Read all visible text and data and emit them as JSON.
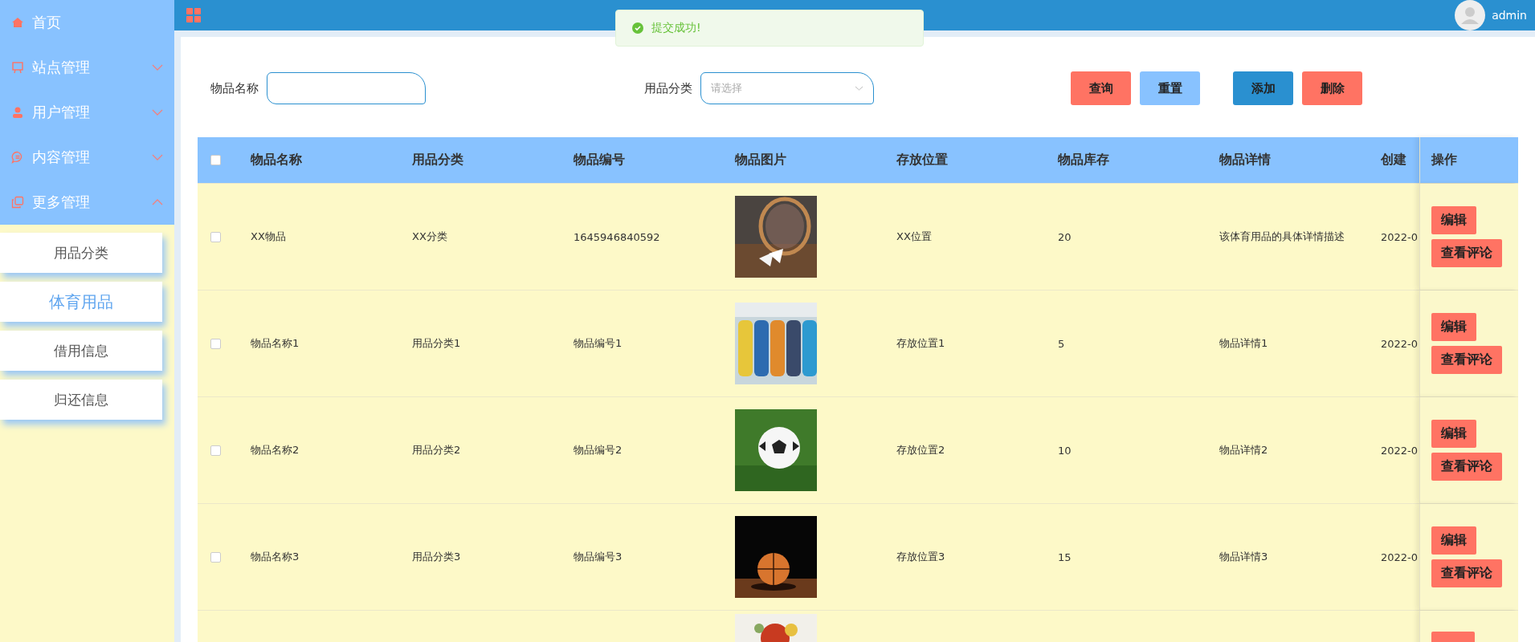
{
  "sidebar": {
    "menu": [
      {
        "label": "首页",
        "kind": "link"
      },
      {
        "label": "站点管理",
        "kind": "submenu",
        "expanded": false
      },
      {
        "label": "用户管理",
        "kind": "submenu",
        "expanded": false
      },
      {
        "label": "内容管理",
        "kind": "submenu",
        "expanded": false
      },
      {
        "label": "更多管理",
        "kind": "submenu",
        "expanded": true
      }
    ],
    "submenu": [
      {
        "label": "用品分类",
        "selected": false
      },
      {
        "label": "体育用品",
        "selected": true
      },
      {
        "label": "借用信息",
        "selected": false
      },
      {
        "label": "归还信息",
        "selected": false
      }
    ]
  },
  "header": {
    "user": "admin"
  },
  "toast": {
    "text": "提交成功!"
  },
  "filters": [
    {
      "label": "物品名称",
      "kind": "input"
    },
    {
      "label": "用品分类",
      "kind": "select",
      "placeholder": "请选择"
    }
  ],
  "buttons": [
    {
      "label": "查询",
      "kind": "danger"
    },
    {
      "label": "重置",
      "kind": "info"
    },
    {
      "label": "添加",
      "kind": "primary"
    },
    {
      "label": "删除",
      "kind": "danger"
    }
  ],
  "table": {
    "all_checked": false,
    "columns": [
      "物品名称",
      "用品分类",
      "物品编号",
      "物品图片",
      "存放位置",
      "物品库存",
      "物品详情",
      "创建",
      "操作"
    ],
    "rows": [
      {
        "checked": false,
        "cells": [
          "XX物品",
          "XX分类",
          "1645946840592",
          "",
          "XX位置",
          "20",
          "该体育用品的具体详情描述",
          "2022-0"
        ],
        "actions": [
          "编辑",
          "查看评论"
        ]
      },
      {
        "checked": false,
        "cells": [
          "物品名称1",
          "用品分类1",
          "物品编号1",
          "",
          "存放位置1",
          "5",
          "物品详情1",
          "2022-0"
        ],
        "actions": [
          "编辑",
          "查看评论"
        ]
      },
      {
        "checked": false,
        "cells": [
          "物品名称2",
          "用品分类2",
          "物品编号2",
          "",
          "存放位置2",
          "10",
          "物品详情2",
          "2022-0"
        ],
        "actions": [
          "编辑",
          "查看评论"
        ]
      },
      {
        "checked": false,
        "cells": [
          "物品名称3",
          "用品分类3",
          "物品编号3",
          "",
          "存放位置3",
          "15",
          "物品详情3",
          "2022-0"
        ],
        "actions": [
          "编辑",
          "查看评论"
        ]
      },
      {
        "cells": []
      }
    ]
  }
}
